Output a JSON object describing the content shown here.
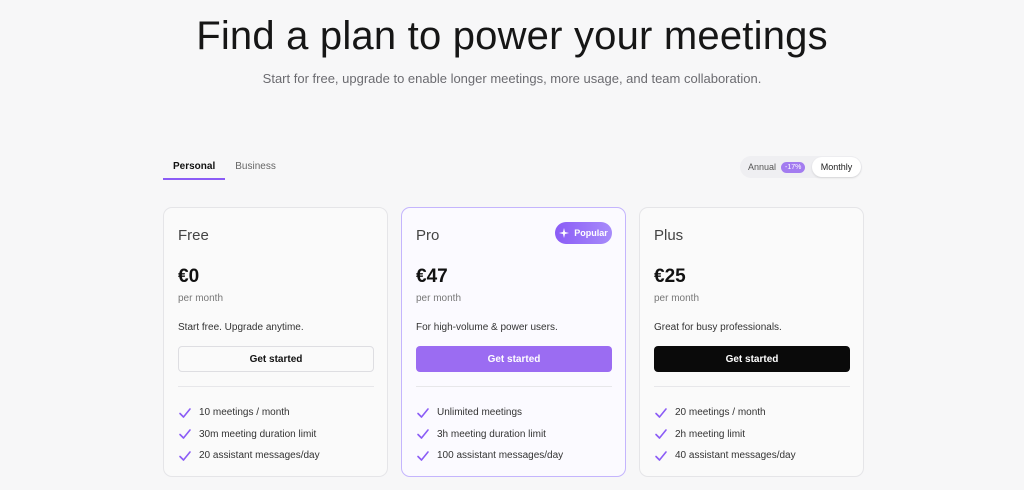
{
  "hero": {
    "title": "Find a plan to power your meetings",
    "subtitle": "Start for free, upgrade to enable longer meetings, more usage, and team collaboration."
  },
  "tabs": [
    {
      "label": "Personal",
      "active": true
    },
    {
      "label": "Business",
      "active": false
    }
  ],
  "billing": {
    "annual_label": "Annual",
    "discount": "-17%",
    "monthly_label": "Monthly",
    "selected": "Monthly"
  },
  "plans": [
    {
      "name": "Free",
      "price": "€0",
      "period": "per month",
      "description": "Start free. Upgrade anytime.",
      "cta": "Get started",
      "features": [
        "10 meetings / month",
        "30m meeting duration limit",
        "20 assistant messages/day"
      ]
    },
    {
      "name": "Pro",
      "badge": "Popular",
      "price": "€47",
      "period": "per month",
      "description": "For high-volume & power users.",
      "cta": "Get started",
      "features": [
        "Unlimited meetings",
        "3h meeting duration limit",
        "100 assistant messages/day"
      ]
    },
    {
      "name": "Plus",
      "price": "€25",
      "period": "per month",
      "description": "Great for busy professionals.",
      "cta": "Get started",
      "features": [
        "20 meetings / month",
        "2h meeting limit",
        "40 assistant messages/day"
      ]
    }
  ],
  "colors": {
    "accent": "#8b5cf6",
    "check": "#8b5cf6",
    "pro_button": "#9b6cf2",
    "plus_button": "#0a0a0a"
  },
  "icons": {
    "feature": "check-icon",
    "badge": "sparkle-icon"
  }
}
